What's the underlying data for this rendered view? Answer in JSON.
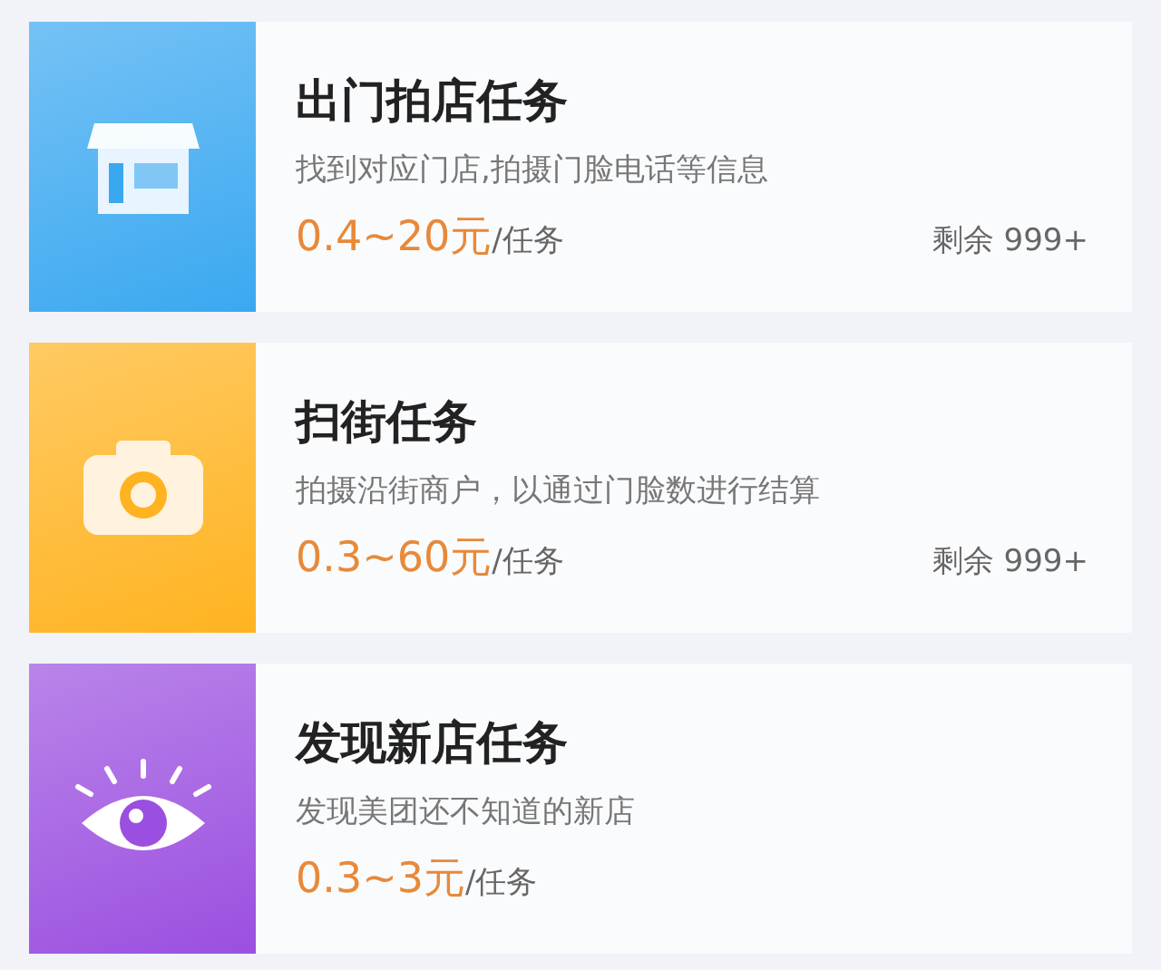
{
  "tasks": [
    {
      "kind": "store",
      "color": "#3aa8f0",
      "title": "出门拍店任务",
      "description": "找到对应门店,拍摄门脸电话等信息",
      "price": "0.4~20元",
      "unit": "/任务",
      "remaining": "剩余 999+"
    },
    {
      "kind": "camera",
      "color": "#ffb320",
      "title": "扫街任务",
      "description": "拍摄沿街商户，以通过门脸数进行结算",
      "price": "0.3~60元",
      "unit": "/任务",
      "remaining": "剩余 999+"
    },
    {
      "kind": "eye",
      "color": "#9b4fe0",
      "title": "发现新店任务",
      "description": "发现美团还不知道的新店",
      "price": "0.3~3元",
      "unit": "/任务"
    }
  ]
}
